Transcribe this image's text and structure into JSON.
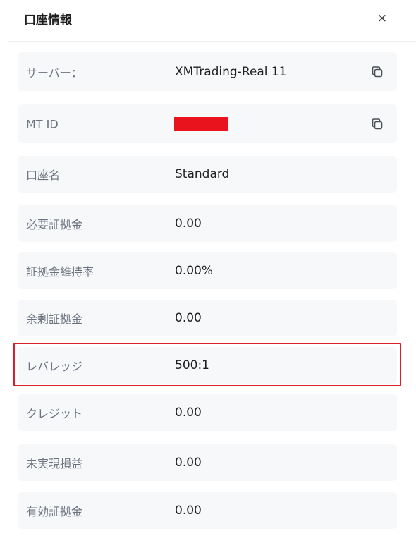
{
  "header": {
    "title": "口座情報",
    "close_label": "×"
  },
  "rows": [
    {
      "label": "サーバー：",
      "value": "XMTrading-Real 11",
      "copy": true
    },
    {
      "label": "MT ID",
      "value": "",
      "redacted": true,
      "copy": true
    },
    {
      "label": "口座名",
      "value": "Standard"
    },
    {
      "label": "必要証拠金",
      "value": "0.00"
    },
    {
      "label": "証拠金維持率",
      "value": "0.00%"
    },
    {
      "label": "余剰証拠金",
      "value": "0.00"
    },
    {
      "label": "レバレッジ",
      "value": "500:1",
      "highlighted": true
    },
    {
      "label": "クレジット",
      "value": "0.00"
    },
    {
      "label": "未実現損益",
      "value": "0.00"
    },
    {
      "label": "有効証拠金",
      "value": "0.00"
    }
  ],
  "colors": {
    "row_background": "#f7f8fa",
    "redaction": "#e8131c",
    "highlight_border": "#d9202a",
    "label_text": "#6b7280",
    "value_text": "#1f1f1f"
  },
  "icons": {
    "copy": "copy-icon",
    "close": "close-icon"
  }
}
